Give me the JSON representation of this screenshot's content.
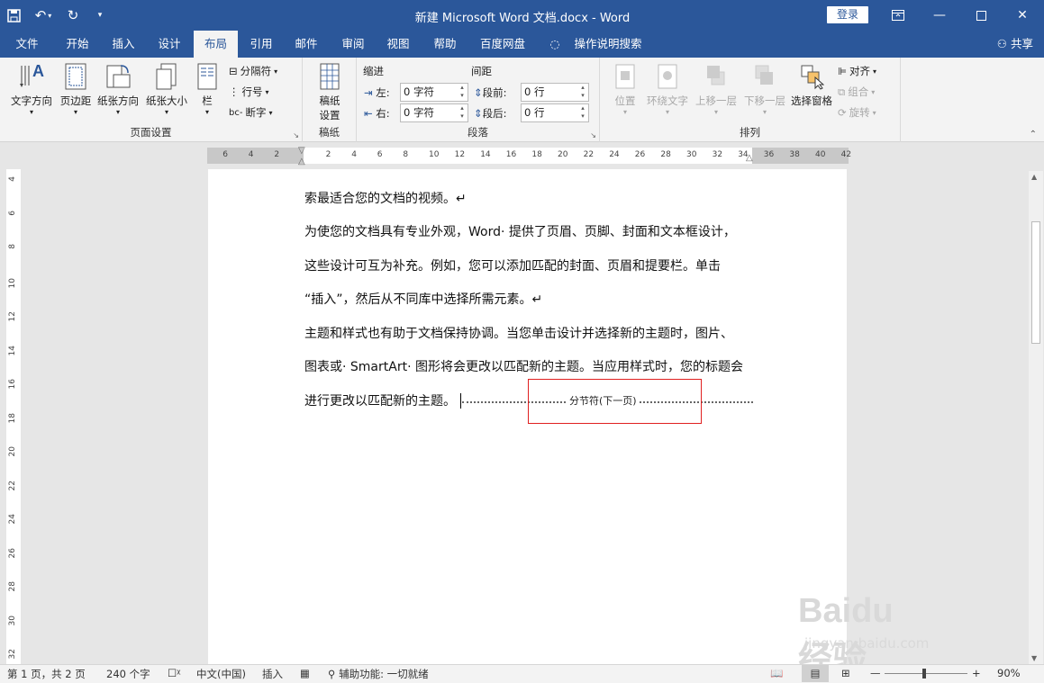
{
  "window": {
    "title": "新建 Microsoft Word 文档.docx  -  Word",
    "login_label": "登录"
  },
  "tabs": [
    "文件",
    "开始",
    "插入",
    "设计",
    "布局",
    "引用",
    "邮件",
    "审阅",
    "视图",
    "帮助",
    "百度网盘",
    "操作说明搜索"
  ],
  "share_label": "共享",
  "ribbon": {
    "page_setup": {
      "label": "页面设置",
      "buttons": [
        "文字方向",
        "页边距",
        "纸张方向",
        "纸张大小",
        "栏"
      ],
      "small": [
        "分隔符",
        "行号",
        "断字"
      ]
    },
    "manuscript": {
      "label": "稿纸",
      "button": "稿纸\n设置",
      "line1": "稿纸",
      "line2": "设置"
    },
    "paragraph": {
      "label": "段落",
      "indent_header": "缩进",
      "spacing_header": "间距",
      "left_label": "左:",
      "right_label": "右:",
      "left_value": "0 字符",
      "right_value": "0 字符",
      "before_label": "段前:",
      "after_label": "段后:",
      "before_value": "0 行",
      "after_value": "0 行"
    },
    "arrange": {
      "label": "排列",
      "buttons": [
        "位置",
        "环绕文字",
        "上移一层",
        "下移一层",
        "选择窗格"
      ],
      "small": [
        "对齐",
        "组合",
        "旋转"
      ]
    }
  },
  "ruler": {
    "h_left": [
      "6",
      "4",
      "2"
    ],
    "h_right": [
      "2",
      "4",
      "6",
      "8",
      "10",
      "12",
      "14",
      "16",
      "18",
      "20",
      "22",
      "24",
      "26",
      "28",
      "30",
      "32",
      "34",
      "36",
      "38",
      "40",
      "42"
    ],
    "v_labels": [
      "4",
      "6",
      "8",
      "10",
      "12",
      "14",
      "16",
      "18",
      "20",
      "22",
      "24",
      "26",
      "28",
      "30",
      "32"
    ]
  },
  "document": {
    "lines": [
      "索最适合您的文档的视频。↵",
      "为使您的文档具有专业外观，Word· 提供了页眉、页脚、封面和文本框设计，",
      "这些设计可互为补充。例如，您可以添加匹配的封面、页眉和提要栏。单击",
      "“插入”，然后从不同库中选择所需元素。↵",
      "主题和样式也有助于文档保持协调。当您单击设计并选择新的主题时，图片、",
      "图表或· SmartArt· 图形将会更改以匹配新的主题。当应用样式时，您的标题会",
      "进行更改以匹配新的主题。"
    ],
    "section_break": "分节符(下一页)"
  },
  "status": {
    "page": "第 1 页，共 2 页",
    "words": "240 个字",
    "language": "中文(中国)",
    "mode": "插入",
    "accessibility": "辅助功能: 一切就绪",
    "zoom": "90%"
  },
  "watermark": {
    "brand": "Baidu经验",
    "url": "jingyan.baidu.com"
  }
}
